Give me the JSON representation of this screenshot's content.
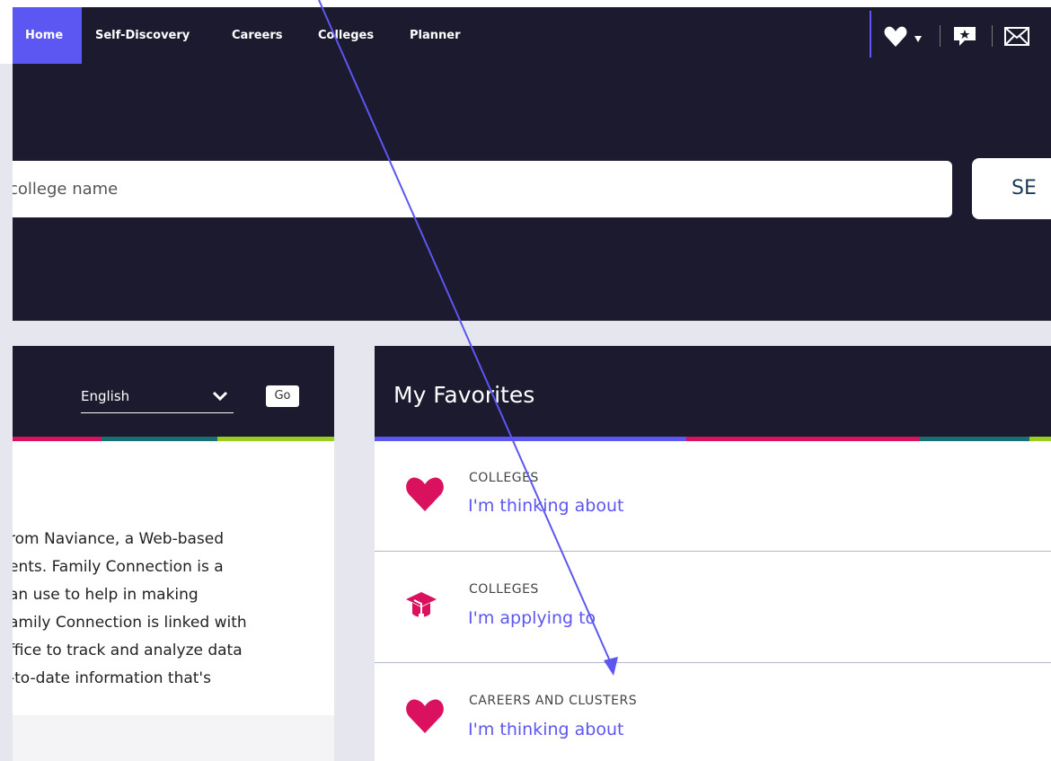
{
  "nav": {
    "items": [
      "Home",
      "Self-Discovery",
      "Careers",
      "Colleges",
      "Planner"
    ],
    "active": "Home",
    "icons": [
      "heart-dropdown-icon",
      "message-star-icon",
      "mail-icon"
    ]
  },
  "search": {
    "placeholder": "college name",
    "button_label": "SE"
  },
  "left_panel": {
    "language": "English",
    "go_label": "Go",
    "text_lines": [
      "rom Naviance, a Web-based",
      "ents. Family Connection is a",
      "an use to help in making",
      "amily Connection is linked with",
      "ffice to track and analyze data",
      "-to-date information that's"
    ]
  },
  "favorites": {
    "title": "My Favorites",
    "rows": [
      {
        "category": "COLLEGES",
        "link": "I'm thinking about",
        "icon": "heart-icon"
      },
      {
        "category": "COLLEGES",
        "link": "I'm applying to",
        "icon": "graduation-cap-icon"
      },
      {
        "category": "CAREERS AND CLUSTERS",
        "link": "I'm thinking about",
        "icon": "heart-icon"
      }
    ]
  },
  "colors": {
    "dark": "#1b1a2e",
    "accent": "#5c56f2",
    "pink": "#d9115e",
    "teal": "#1a6f73",
    "lime": "#9acd1f"
  }
}
